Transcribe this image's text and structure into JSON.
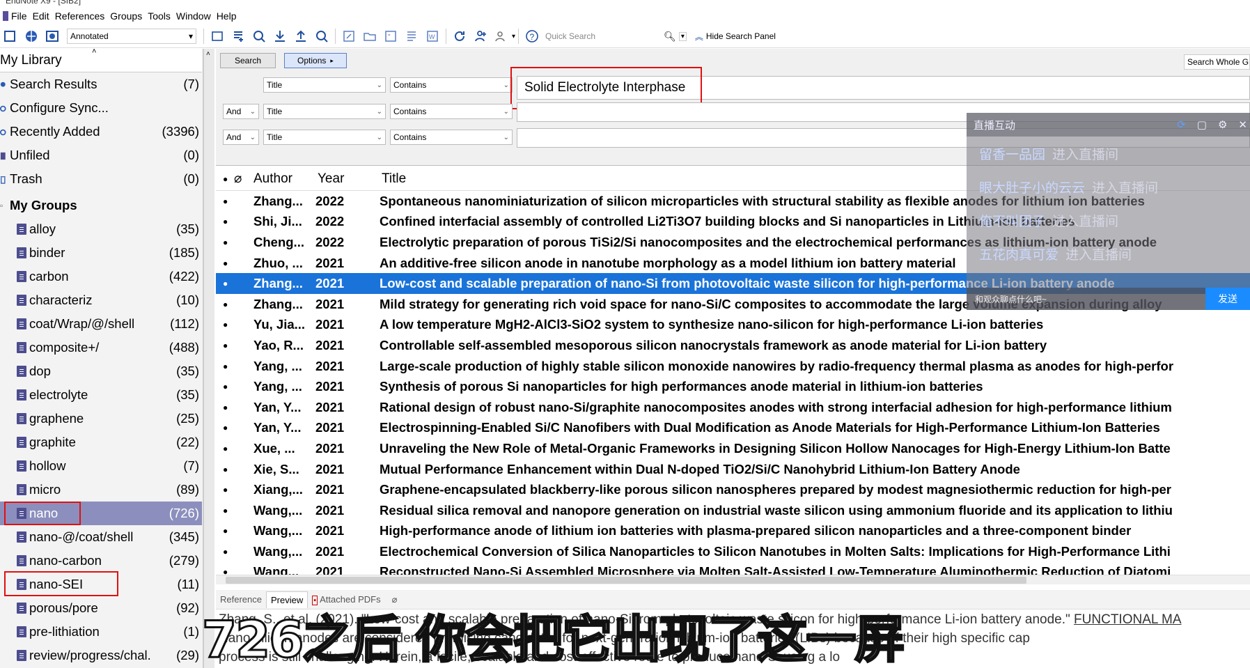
{
  "window": {
    "title": "EndNote X9 - [SIB2]"
  },
  "menu": [
    "File",
    "Edit",
    "References",
    "Groups",
    "Tools",
    "Window",
    "Help"
  ],
  "toolbar": {
    "style": "Annotated",
    "quick_search_placeholder": "Quick Search",
    "hide_panel": "Hide Search Panel"
  },
  "library": {
    "header": "My Library",
    "items": [
      {
        "label": "Search Results",
        "count": "(7)"
      },
      {
        "label": "Configure Sync...",
        "count": ""
      },
      {
        "label": "Recently Added",
        "count": "(3396)"
      },
      {
        "label": "Unfiled",
        "count": "(0)"
      },
      {
        "label": "Trash",
        "count": "(0)"
      }
    ],
    "groups_header": "My Groups",
    "groups": [
      {
        "label": "alloy",
        "count": "(35)"
      },
      {
        "label": "binder",
        "count": "(185)"
      },
      {
        "label": "carbon",
        "count": "(422)"
      },
      {
        "label": "characteriz",
        "count": "(10)"
      },
      {
        "label": "coat/Wrap/@/shell",
        "count": "(112)"
      },
      {
        "label": "composite+/",
        "count": "(488)"
      },
      {
        "label": "dop",
        "count": "(35)"
      },
      {
        "label": "electrolyte",
        "count": "(35)"
      },
      {
        "label": "graphene",
        "count": "(25)"
      },
      {
        "label": "graphite",
        "count": "(22)"
      },
      {
        "label": "hollow",
        "count": "(7)"
      },
      {
        "label": "micro",
        "count": "(89)"
      },
      {
        "label": "nano",
        "count": "(726)"
      },
      {
        "label": "nano-@/coat/shell",
        "count": "(345)"
      },
      {
        "label": "nano-carbon",
        "count": "(279)"
      },
      {
        "label": "nano-SEI",
        "count": "(11)"
      },
      {
        "label": "porous/pore",
        "count": "(92)"
      },
      {
        "label": "pre-lithiation",
        "count": "(1)"
      },
      {
        "label": "review/progress/chal...",
        "count": "(29)"
      }
    ]
  },
  "search": {
    "search_btn": "Search",
    "options_btn": "Options",
    "scope": "Search Whole G",
    "rows": [
      {
        "bool": "",
        "field": "Title",
        "op": "Contains",
        "value": "Solid Electrolyte Interphase"
      },
      {
        "bool": "And",
        "field": "Title",
        "op": "Contains",
        "value": ""
      },
      {
        "bool": "And",
        "field": "Title",
        "op": "Contains",
        "value": ""
      }
    ]
  },
  "table": {
    "columns": [
      "Author",
      "Year",
      "Title"
    ],
    "rows": [
      {
        "author": "Zhang...",
        "year": "2022",
        "title": "Spontaneous nanominiaturization of silicon microparticles with structural stability as flexible anodes for lithium ion batteries"
      },
      {
        "author": "Shi, Ji...",
        "year": "2022",
        "title": "Confined interfacial assembly of controlled Li2Ti3O7 building blocks and Si nanoparticles in Lithium-ion batteries"
      },
      {
        "author": "Cheng...",
        "year": "2022",
        "title": "Electrolytic preparation of porous TiSi2/Si nanocomposites and the electrochemical performances as lithium-ion battery anode"
      },
      {
        "author": "Zhuo, ...",
        "year": "2021",
        "title": "An additive-free silicon anode in nanotube morphology as a model lithium ion battery material"
      },
      {
        "author": "Zhang...",
        "year": "2021",
        "title": "Low-cost and scalable preparation of nano-Si from photovoltaic waste silicon for high-performance Li-ion battery anode"
      },
      {
        "author": "Zhang...",
        "year": "2021",
        "title": "Mild strategy for generating rich void space for nano-Si/C composites to accommodate the large volume expansion during alloy"
      },
      {
        "author": "Yu, Jia...",
        "year": "2021",
        "title": "A low temperature MgH2-AlCl3-SiO2 system to synthesize nano-silicon for high-performance Li-ion batteries"
      },
      {
        "author": "Yao, R...",
        "year": "2021",
        "title": "Controllable self-assembled mesoporous silicon nanocrystals framework as anode material for Li-ion battery"
      },
      {
        "author": "Yang, ...",
        "year": "2021",
        "title": "Large-scale production of highly stable silicon monoxide nanowires by radio-frequency thermal plasma as anodes for high-perfor"
      },
      {
        "author": "Yang, ...",
        "year": "2021",
        "title": "Synthesis of porous Si nanoparticles for high performances anode material in lithium-ion batteries"
      },
      {
        "author": "Yan, Y...",
        "year": "2021",
        "title": "Rational design of robust nano-Si/graphite nanocomposites anodes with strong interfacial adhesion for high-performance lithium"
      },
      {
        "author": "Yan, Y...",
        "year": "2021",
        "title": "Electrospinning-Enabled Si/C Nanofibers with Dual Modification as Anode Materials for High-Performance Lithium-Ion Batteries"
      },
      {
        "author": "Xue, ...",
        "year": "2021",
        "title": "Unraveling the New Role of Metal-Organic Frameworks in Designing Silicon Hollow Nanocages for High-Energy Lithium-Ion Batte"
      },
      {
        "author": "Xie, S...",
        "year": "2021",
        "title": "Mutual Performance Enhancement within Dual N-doped TiO2/Si/C Nanohybrid Lithium-Ion Battery Anode"
      },
      {
        "author": "Xiang,...",
        "year": "2021",
        "title": "Graphene-encapsulated blackberry-like porous silicon nanospheres prepared by modest magnesiothermic reduction for high-per"
      },
      {
        "author": "Wang,...",
        "year": "2021",
        "title": "Residual silica removal and nanopore generation on industrial waste silicon using ammonium fluoride and its application to lithiu"
      },
      {
        "author": "Wang,...",
        "year": "2021",
        "title": "High-performance anode of lithium ion batteries with plasma-prepared silicon nanoparticles and a three-component binder"
      },
      {
        "author": "Wang,...",
        "year": "2021",
        "title": "Electrochemical Conversion of Silica Nanoparticles to Silicon Nanotubes in Molten Salts: Implications for High-Performance Lithi"
      },
      {
        "author": "Wang...",
        "year": "2021",
        "title": "Reconstructed Nano-Si Assembled Microsphere via Molten Salt-Assisted Low-Temperature Aluminothermic Reduction of Diatomi"
      }
    ]
  },
  "tabs": [
    "Reference",
    "Preview",
    "Attached PDFs"
  ],
  "preview": {
    "line1": "Zhang, S., et al. (2021). \"Low-cost and scalable preparation of nano-Si from photovoltaic waste silicon for high-performance Li-ion battery anode.\"",
    "journal": "FUNCTIONAL MA",
    "line2": "Nano-silicon anodes are considered promising candidates for next-generation lithium-ion batteries (LIBs) because of their high specific cap",
    "line3": "process is still challenging. Herein, a facile, scalable and cost-effective route to produce nano-Si using a lo"
  },
  "overlay": {
    "title": "直播互动",
    "items": [
      {
        "name": "留香一品园",
        "action": "进入直播间"
      },
      {
        "name": "眼大肚子小的云云",
        "action": "进入直播间"
      },
      {
        "name": "俺不叫团子",
        "action": "进入直播间"
      },
      {
        "name": "五花肉真可爱",
        "action": "进入直播间"
      }
    ],
    "input_placeholder": "和观众聊点什么吧~",
    "send": "发送"
  },
  "subtitle": "726之后 你会把它出现了这一屏",
  "colors": {
    "selection": "#1a73d9",
    "group_selected": "#8c8fbd",
    "highlight_box": "#e01010"
  }
}
